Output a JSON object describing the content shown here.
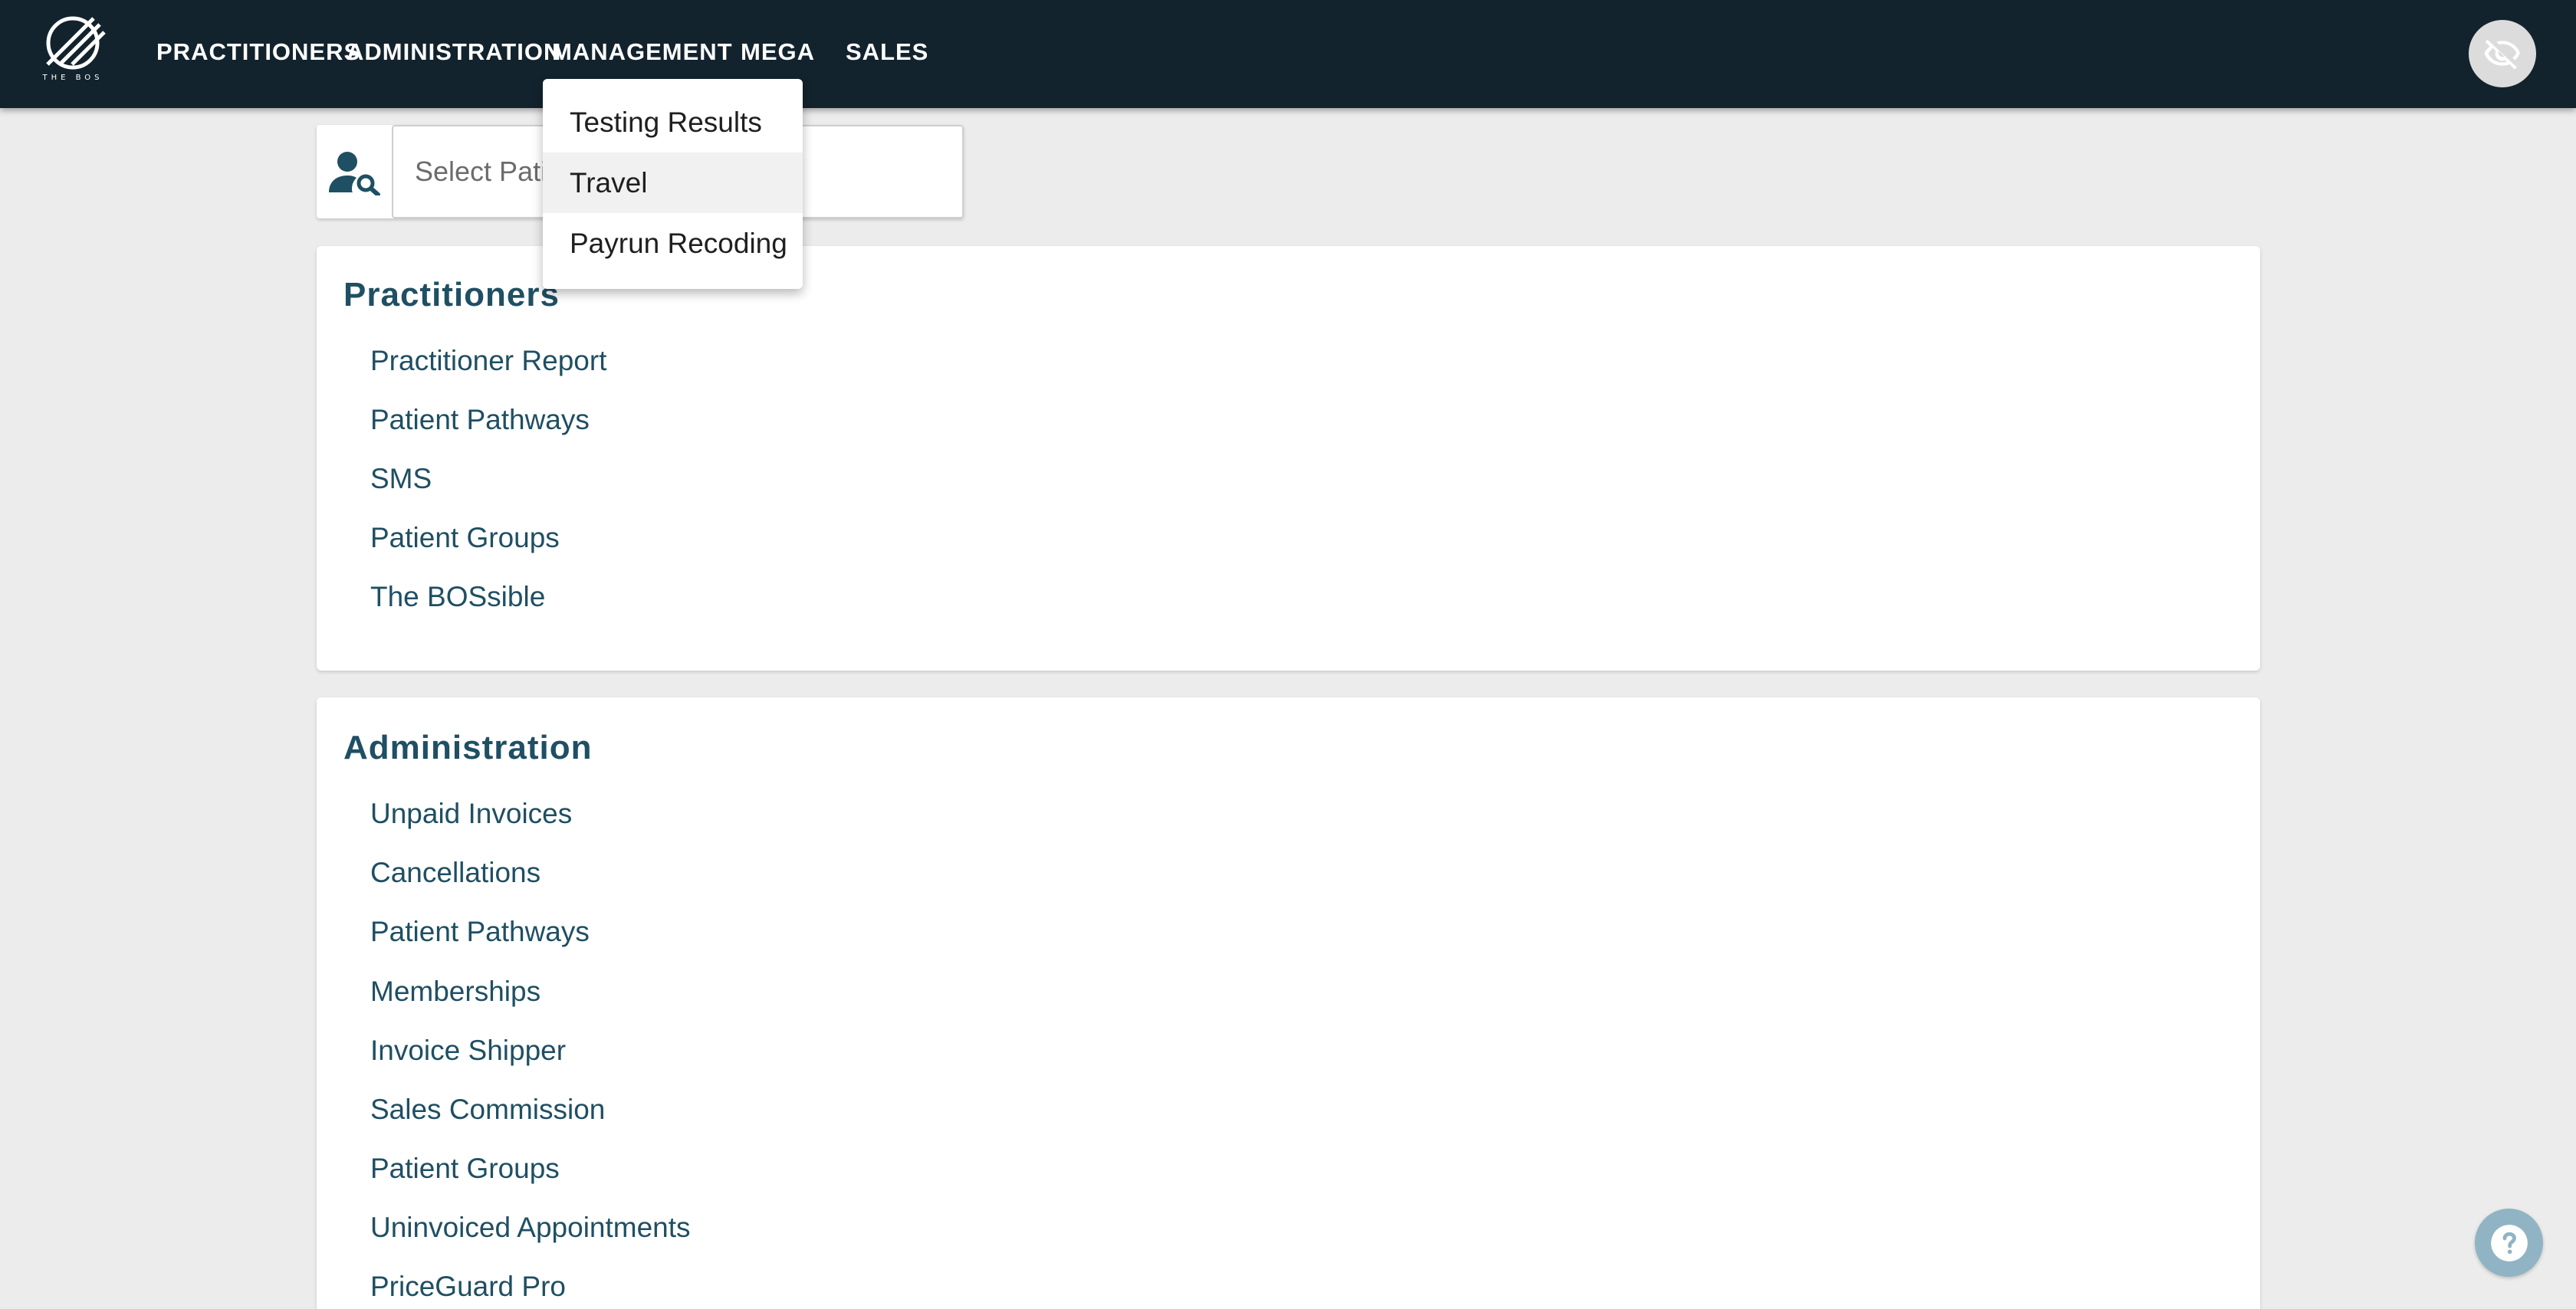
{
  "app": {
    "logo_text": "THE BOS",
    "nav": [
      "PRACTITIONERS",
      "ADMINISTRATION",
      "MANAGEMENT",
      "MEGA",
      "SALES"
    ]
  },
  "search": {
    "placeholder": "Select Patient"
  },
  "dropdown": {
    "open_menu": "MANAGEMENT",
    "items": [
      "Testing Results",
      "Travel",
      "Payrun Recoding"
    ],
    "hovered": "Travel"
  },
  "sections": [
    {
      "title": "Practitioners",
      "links": [
        "Practitioner Report",
        "Patient Pathways",
        "SMS",
        "Patient Groups",
        "The BOSsible"
      ]
    },
    {
      "title": "Administration",
      "links": [
        "Unpaid Invoices",
        "Cancellations",
        "Patient Pathways",
        "Memberships",
        "Invoice Shipper",
        "Sales Commission",
        "Patient Groups",
        "Uninvoiced Appointments",
        "PriceGuard Pro"
      ]
    }
  ],
  "icons": {
    "visibility": "eye-off-icon",
    "help": "help-icon",
    "search": "user-search-icon",
    "logo": "bos-logo"
  },
  "colors": {
    "topbar": "#12232e",
    "accent": "#1f4f63",
    "background": "#ececec"
  }
}
